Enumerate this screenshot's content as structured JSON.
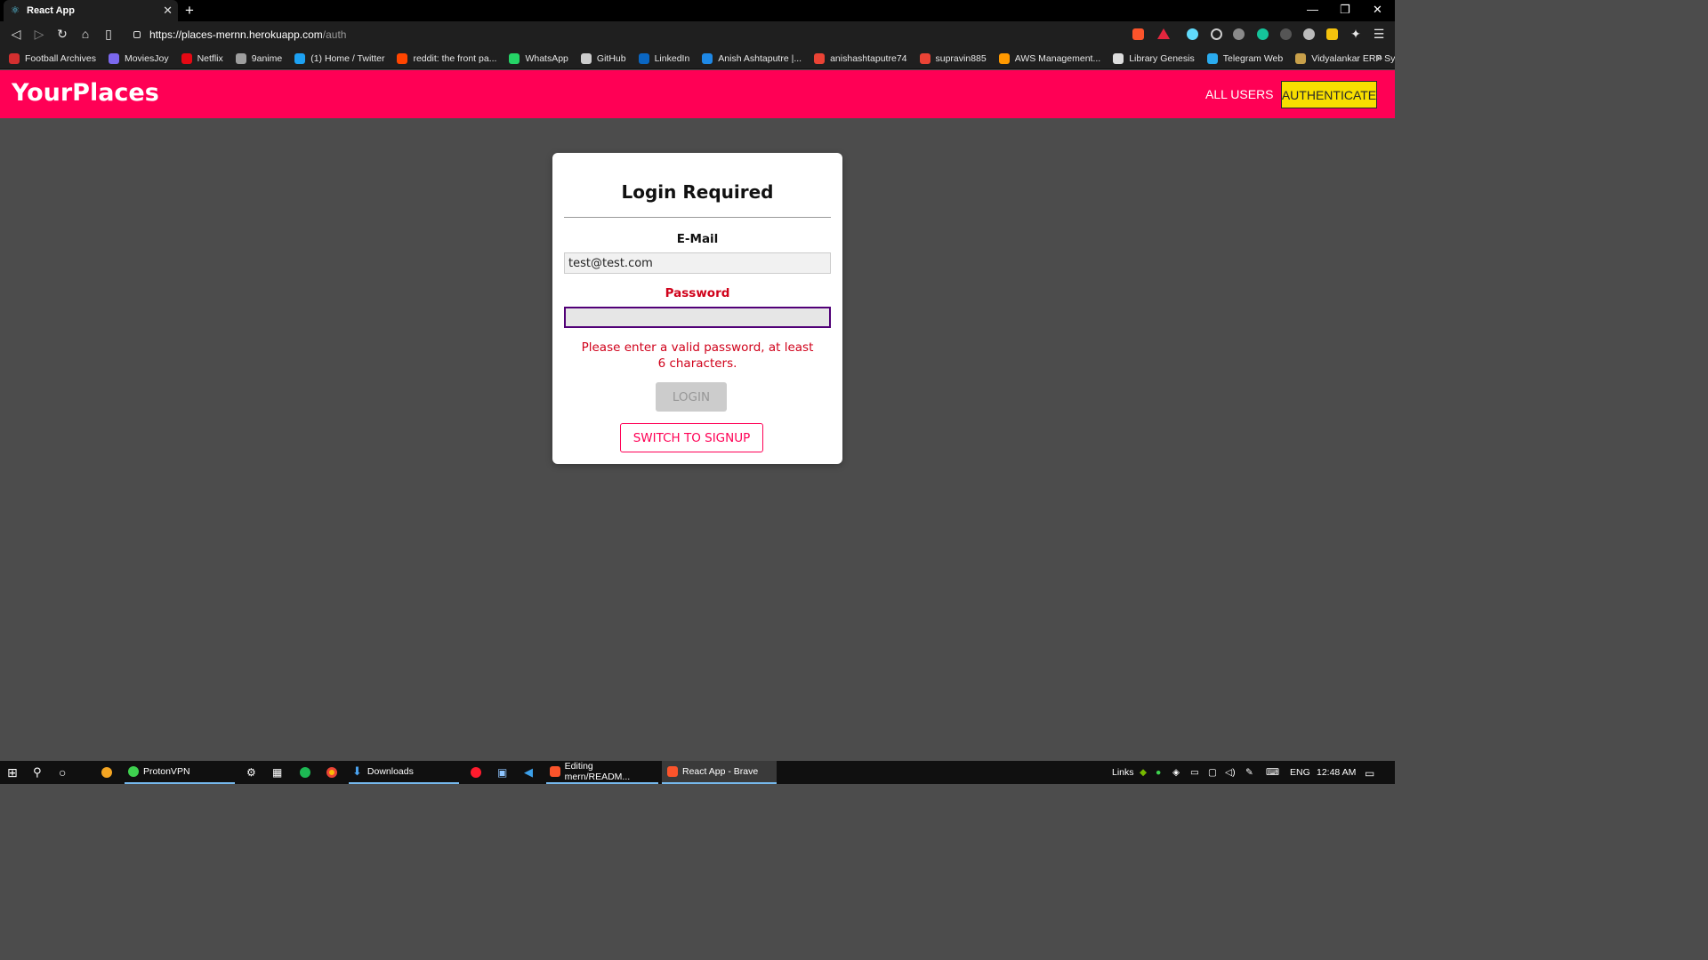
{
  "browser": {
    "tab_title": "React App",
    "url_host": "https://places-mernn.herokuapp.com",
    "url_path": "/auth",
    "bookmarks": [
      {
        "label": "Football Archives",
        "icon": "ts-icon",
        "color": "#d32f2f"
      },
      {
        "label": "MoviesJoy",
        "icon": "moviesjoy-icon",
        "color": "#7b68ee"
      },
      {
        "label": "Netflix",
        "icon": "netflix-icon",
        "color": "#e50914"
      },
      {
        "label": "9anime",
        "icon": "9anime-icon",
        "color": "#9e9e9e"
      },
      {
        "label": "(1) Home / Twitter",
        "icon": "twitter-icon",
        "color": "#1da1f2"
      },
      {
        "label": "reddit: the front pa...",
        "icon": "reddit-icon",
        "color": "#ff4500"
      },
      {
        "label": "WhatsApp",
        "icon": "whatsapp-icon",
        "color": "#25d366"
      },
      {
        "label": "GitHub",
        "icon": "github-icon",
        "color": "#cccccc"
      },
      {
        "label": "LinkedIn",
        "icon": "linkedin-icon",
        "color": "#0a66c2"
      },
      {
        "label": "Anish Ashtaputre |...",
        "icon": "k-icon",
        "color": "#1e88e5"
      },
      {
        "label": "anishashtaputre74",
        "icon": "gmail-icon",
        "color": "#ea4335"
      },
      {
        "label": "supravin885",
        "icon": "gmail-icon",
        "color": "#ea4335"
      },
      {
        "label": "AWS Management...",
        "icon": "aws-icon",
        "color": "#ff9900"
      },
      {
        "label": "Library Genesis",
        "icon": "libgen-icon",
        "color": "#dddddd"
      },
      {
        "label": "Telegram Web",
        "icon": "telegram-icon",
        "color": "#2aabee"
      },
      {
        "label": "Vidyalankar ERP Sys...",
        "icon": "vidyalankar-icon",
        "color": "#c8a04a"
      }
    ]
  },
  "header": {
    "brand": "YourPlaces",
    "nav_users": "ALL USERS",
    "nav_auth": "AUTHENTICATE",
    "color": "#ff0055"
  },
  "auth": {
    "title": "Login Required",
    "email_label": "E-Mail",
    "email_value": "test@test.com",
    "password_label": "Password",
    "password_value": "",
    "error_text": "Please enter a valid password, at least 6 characters.",
    "login_label": "LOGIN",
    "switch_label": "SWITCH TO SIGNUP",
    "error_color": "#d0021b"
  },
  "taskbar": {
    "items": [
      {
        "label": "ProtonVPN"
      },
      {
        "label": "Downloads"
      },
      {
        "label": "Editing mern/READM..."
      },
      {
        "label": "React App - Brave"
      }
    ],
    "links_label": "Links",
    "lang": "ENG",
    "time": "12:48 AM"
  }
}
